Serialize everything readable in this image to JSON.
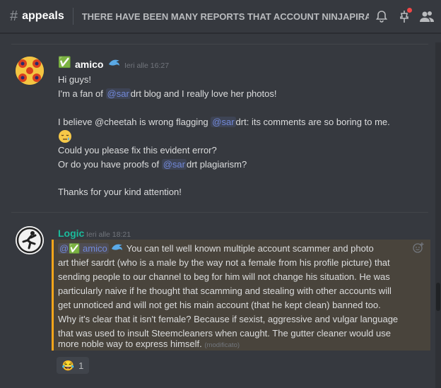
{
  "header": {
    "hash": "#",
    "channel": "appeals",
    "topic": "THERE HAVE BEEN MANY REPORTS THAT ACCOUNT NINJAPIRA..."
  },
  "messages": [
    {
      "username": "amico",
      "username_color": "#ffffff",
      "badge": "✅",
      "timestamp": "Ieri alle 16:27",
      "lines": [
        {
          "text": "Hi guys!"
        },
        {
          "pre": "I'm a fan of ",
          "mention": "@sar",
          "post": "drt blog and I really love her photos!"
        },
        {
          "pre": "I believe @cheetah is wrong flagging ",
          "mention": "@sar",
          "post": "drt: its comments are so boring to me."
        },
        {
          "text": "Could you please fix this evident error?"
        },
        {
          "pre": "Or do you have proofs of ",
          "mention": "@sar",
          "post": "drt plagiarism?"
        },
        {
          "text": "Thanks for your kind attention!"
        }
      ]
    },
    {
      "username": "Logic",
      "username_color": "#1abc9c",
      "timestamp": "Ieri alle 18:21",
      "mention": "@",
      "mention_badge": "✅",
      "mention_name": "amico",
      "lines": [
        {
          "text": "You can tell well known multiple account scammer and photo"
        },
        {
          "text": "art thief sardrt (who is a male by the way not a female from his profile picture) that"
        },
        {
          "text": "sending people to our channel to beg for him will not change his situation. He was"
        },
        {
          "text": "particularly naive if he thought that scamming and stealing with other accounts will"
        },
        {
          "text": "get unnoticed and will not get his main account (that he kept clean) banned too."
        },
        {
          "text": "Why it's clear that it isn't female? Because if sexist, aggressive and vulgar language"
        },
        {
          "text": "that was used to insult Steemcleaners when caught. The gutter cleaner would use"
        },
        {
          "text": "more noble way to express himself."
        }
      ],
      "edited": "(modificato)",
      "reaction": {
        "emoji": "😂",
        "count": "1"
      }
    }
  ],
  "colors": {
    "background": "#36393f",
    "mention": "#7289da",
    "highlight_border": "#faa61a",
    "logic_name": "#1abc9c"
  }
}
